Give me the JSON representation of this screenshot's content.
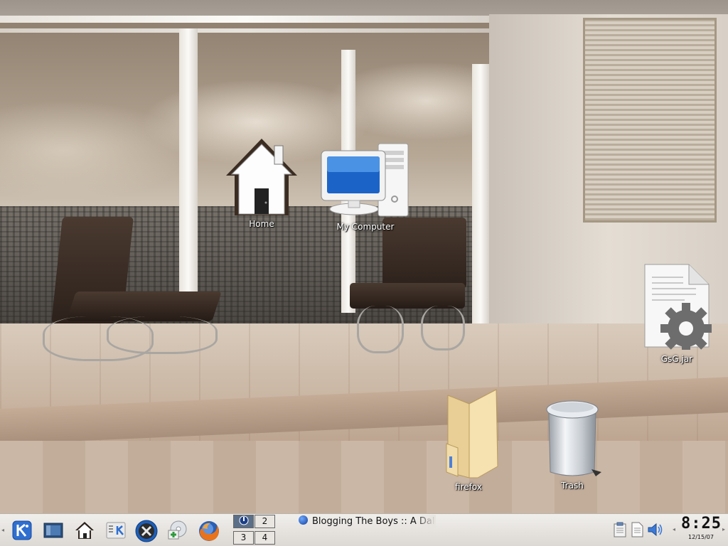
{
  "desktop": {
    "icons": [
      {
        "label": "Home",
        "icon": "home-icon"
      },
      {
        "label": "My Computer",
        "icon": "computer-icon"
      },
      {
        "label": "GsG.jar",
        "icon": "jar-file-icon"
      },
      {
        "label": "firefox",
        "icon": "folder-icon"
      },
      {
        "label": "Trash",
        "icon": "trash-icon"
      }
    ]
  },
  "taskbar": {
    "launchers": [
      {
        "name": "kde-menu",
        "icon": "kde-k-icon"
      },
      {
        "name": "show-desktop",
        "icon": "desktop-icon"
      },
      {
        "name": "home",
        "icon": "home-icon"
      },
      {
        "name": "kcontrol",
        "icon": "control-center-icon"
      },
      {
        "name": "tools",
        "icon": "tools-icon"
      },
      {
        "name": "media",
        "icon": "cd-icon"
      },
      {
        "name": "firefox",
        "icon": "firefox-icon"
      }
    ],
    "pager": {
      "desktops": [
        "1",
        "2",
        "3",
        "4"
      ],
      "active": "1"
    },
    "task": {
      "title": "Blogging The Boys :: A Dal",
      "icon": "firefox-globe-icon"
    },
    "tray": [
      {
        "icon": "clipboard-icon"
      },
      {
        "icon": "notes-icon"
      },
      {
        "icon": "volume-icon"
      }
    ],
    "clock": {
      "time": "8:25",
      "date": "12/15/07"
    }
  },
  "colors": {
    "taskbar_bg": "#e6e3df",
    "pager_active": "#5b6f88",
    "label_text": "#ffffff"
  }
}
